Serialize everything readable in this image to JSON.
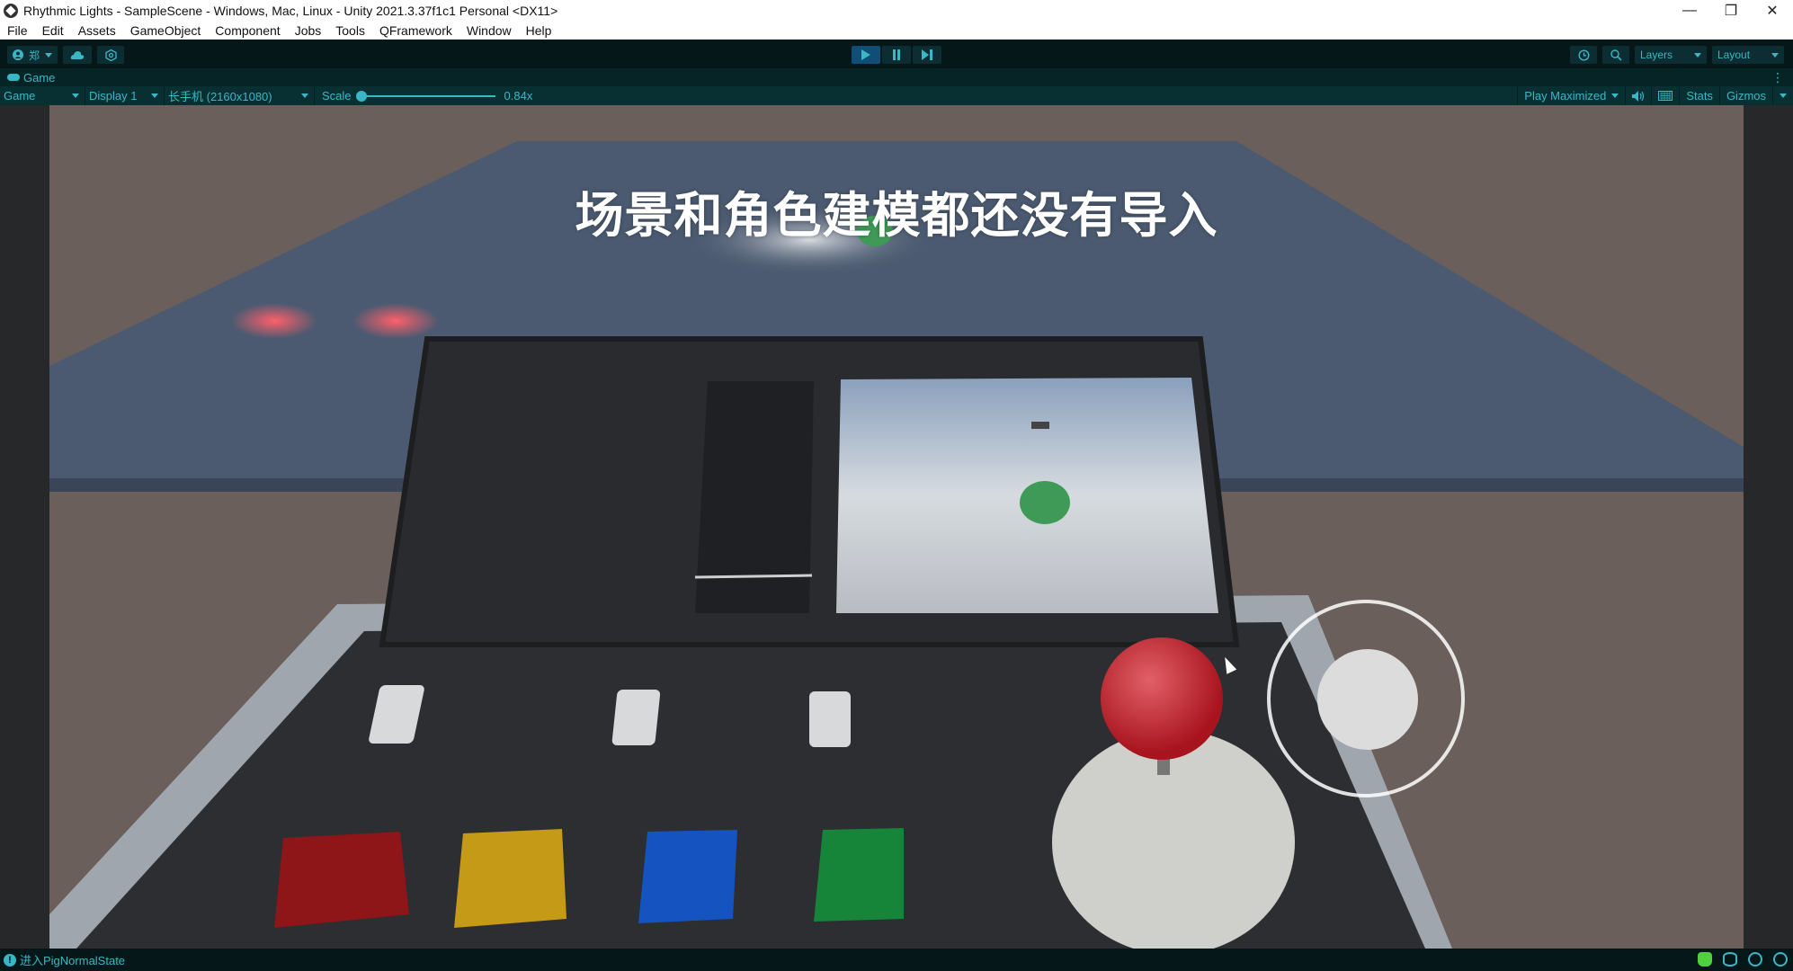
{
  "window": {
    "title": "Rhythmic Lights - SampleScene - Windows, Mac, Linux - Unity 2021.3.37f1c1 Personal <DX11>",
    "controls": {
      "minimize": "—",
      "restore": "❐",
      "close": "✕"
    }
  },
  "menu": {
    "items": [
      "File",
      "Edit",
      "Assets",
      "GameObject",
      "Component",
      "Jobs",
      "Tools",
      "QFramework",
      "Window",
      "Help"
    ]
  },
  "toolbar": {
    "account_label": "郑",
    "cloud_icon": "cloud-icon",
    "collab_icon": "collab-icon",
    "play_icon": "▶",
    "pause_icon": "❚❚",
    "step_icon": "▶❚",
    "history_icon": "⟲",
    "search_icon": "⚲",
    "layers_label": "Layers",
    "layout_label": "Layout"
  },
  "tab": {
    "label": "Game",
    "menu_icon": "⋮"
  },
  "game_toolbar": {
    "view_mode": "Game",
    "display": "Display 1",
    "resolution": "长手机 (2160x1080)",
    "scale_label": "Scale",
    "scale_value": "0.84x",
    "scale_fraction": 0.0,
    "play_mode": "Play Maximized",
    "stats_label": "Stats",
    "gizmos_label": "Gizmos"
  },
  "game_view": {
    "overlay_text": "场景和角色建模都还没有导入",
    "joystick": {
      "x": 0.0,
      "y": 0.0
    },
    "colors": {
      "button_red": "#8e1518",
      "button_yellow": "#c59a16",
      "button_blue": "#1553c0",
      "button_green": "#16853a",
      "joystick_ball": "#c8262f",
      "pig": "#3f9a57",
      "floor": "#4b5a70",
      "background": "#6a5f5a"
    }
  },
  "status": {
    "message": "进入PigNormalState"
  },
  "theme": {
    "accent": "#3ab7c5",
    "toolbar_bg": "#051719",
    "play_active": "#0f4f77"
  }
}
